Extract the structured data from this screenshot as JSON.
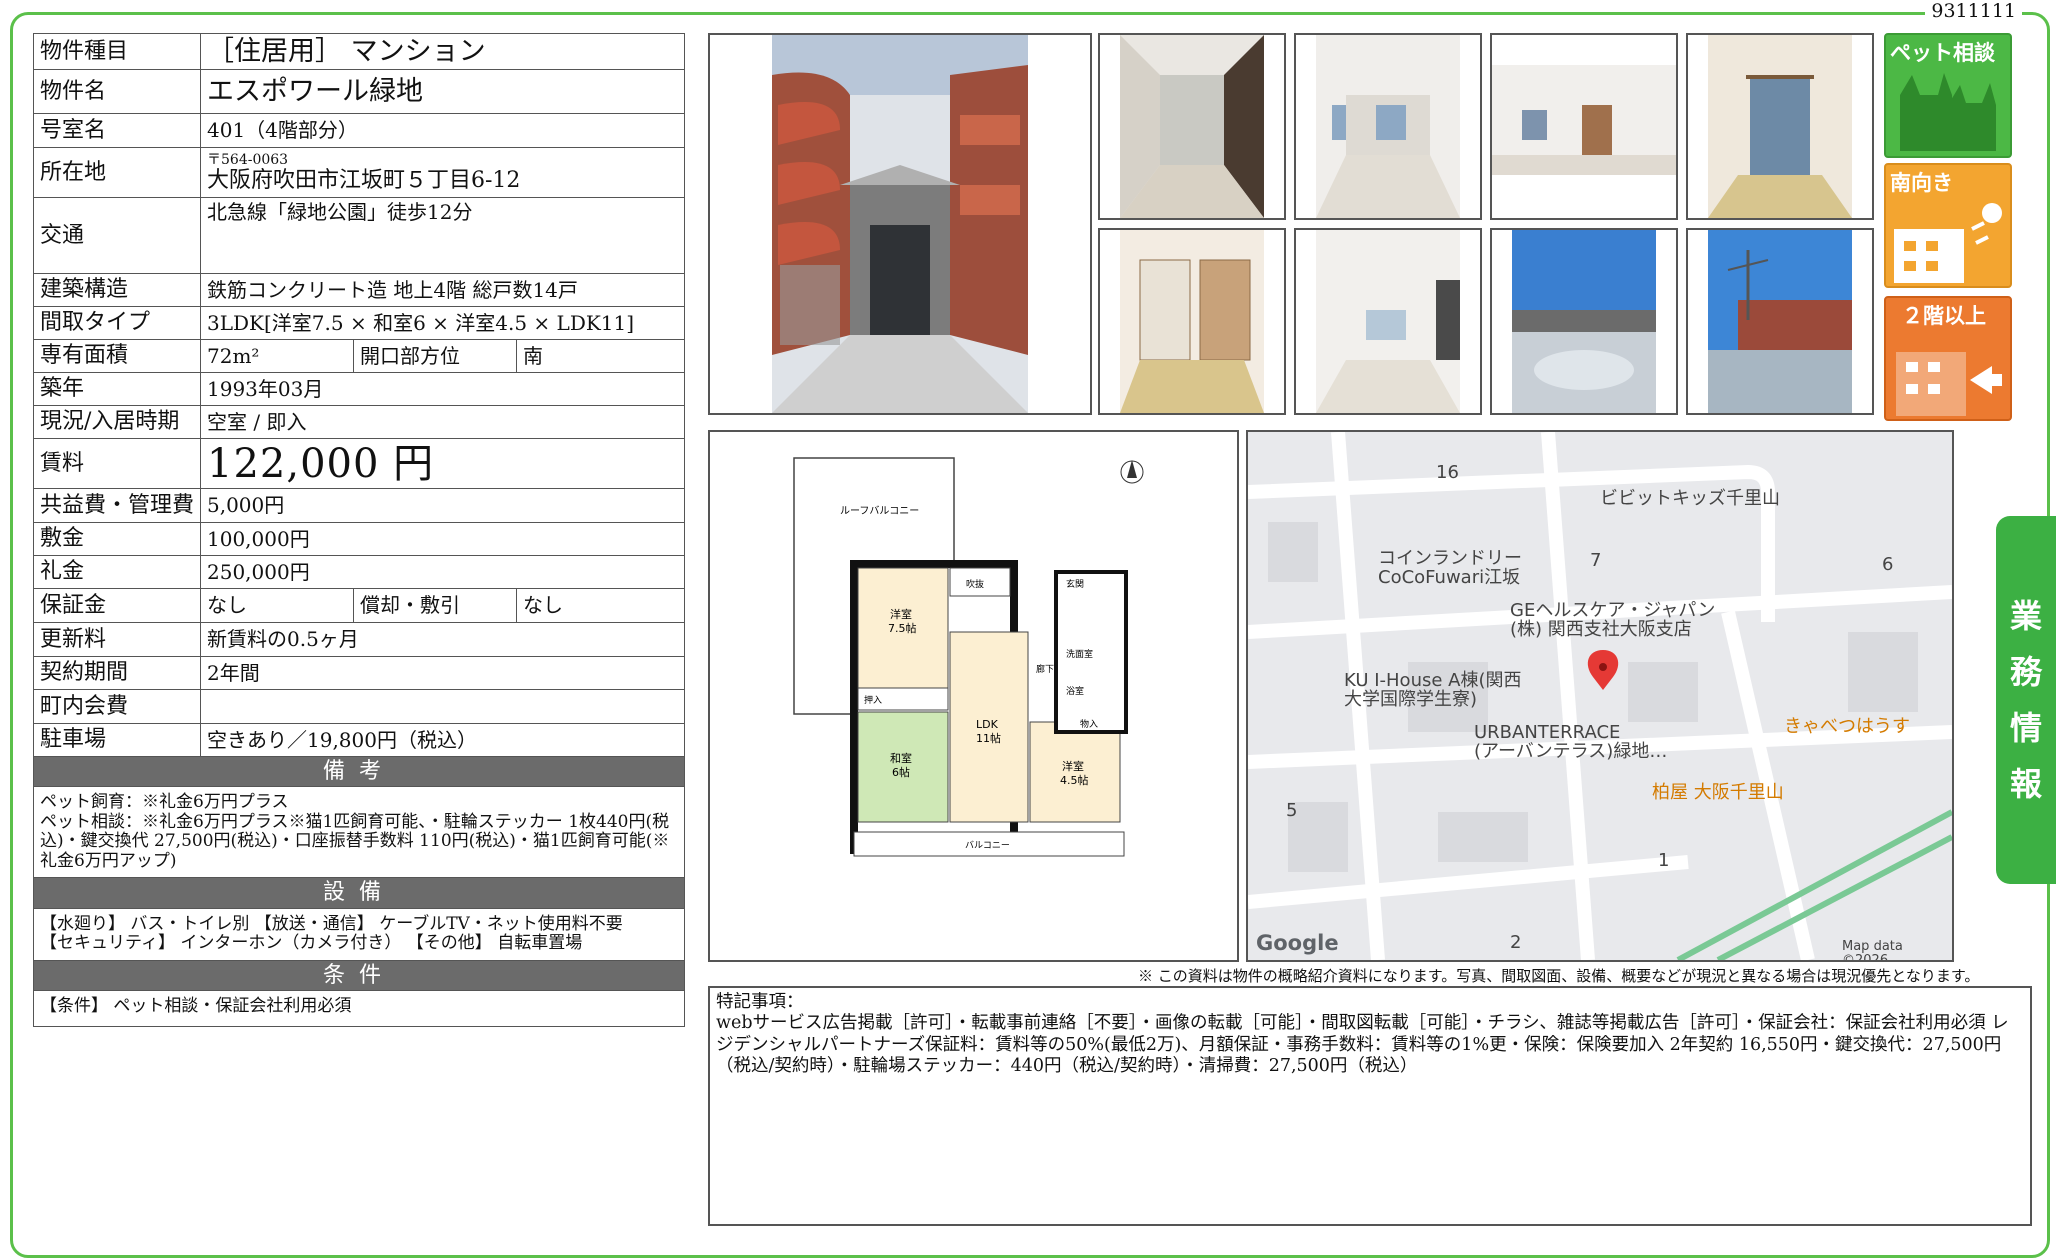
{
  "doc_id": "9311111",
  "property": {
    "type_label": "物件種目",
    "type_value": "［住居用］ マンション",
    "name_label": "物件名",
    "name_value": "エスポワール緑地",
    "room_label": "号室名",
    "room_value": "401（4階部分）",
    "address_label": "所在地",
    "postal": "〒564-0063",
    "address": "大阪府吹田市江坂町５丁目6-12",
    "access_label": "交通",
    "access_value": "北急線「緑地公園」徒歩12分",
    "structure_label": "建築構造",
    "structure_value": "鉄筋コンクリート造 地上4階 総戸数14戸",
    "layout_label": "間取タイプ",
    "layout_value": "3LDK[洋室7.5 × 和室6 × 洋室4.5 × LDK11]",
    "area_label": "専有面積",
    "area_value": "72m²",
    "direction_label": "開口部方位",
    "direction_value": "南",
    "built_label": "築年",
    "built_value": "1993年03月",
    "status_label": "現況/入居時期",
    "status_value": "空室 / 即入",
    "rent_label": "賃料",
    "rent_value": "122,000 円",
    "fee_label": "共益費・管理費",
    "fee_value": "5,000円",
    "deposit_label": "敷金",
    "deposit_value": "100,000円",
    "keymoney_label": "礼金",
    "keymoney_value": "250,000円",
    "guarantee_label": "保証金",
    "guarantee_value": "なし",
    "amort_label": "償却・敷引",
    "amort_value": "なし",
    "renewal_label": "更新料",
    "renewal_value": "新賃料の0.5ヶ月",
    "contract_label": "契約期間",
    "contract_value": "2年間",
    "assoc_label": "町内会費",
    "assoc_value": "",
    "parking_label": "駐車場",
    "parking_value": "空きあり／19,800円（税込）"
  },
  "sections": {
    "remarks_title": "備考",
    "remarks_text": "ペット飼育：※礼金6万円プラス\nペット相談：※礼金6万円プラス※猫1匹飼育可能、・駐輪ステッカー 1枚440円(税込)・鍵交換代 27,500円(税込)・口座振替手数料 110円(税込)・猫1匹飼育可能(※礼金6万円アップ)",
    "facilities_title": "設備",
    "facilities_text": "【水廻り】 バス・トイレ別 【放送・通信】 ケーブルTV・ネット使用料不要\n【セキュリティ】 インターホン（カメラ付き） 【その他】 自転車置場",
    "conditions_title": "条件",
    "conditions_text": "【条件】 ペット相談・保証会社利用必須"
  },
  "badges": [
    "ペット相談",
    "南向き",
    "２階以上"
  ],
  "side_tab": [
    "業",
    "務",
    "情",
    "報"
  ],
  "floorplan": {
    "roof_balcony": "ルーフバルコニー",
    "western1": "洋室",
    "western1_size": "7.5帖",
    "japanese": "和室",
    "japanese_size": "6帖",
    "ldk": "LDK",
    "ldk_size": "11帖",
    "western2": "洋室",
    "western2_size": "4.5帖",
    "balcony": "バルコニー",
    "storage": "物入",
    "closet": "押入",
    "entrance": "玄関",
    "washroom": "洗面室",
    "bath": "浴室",
    "hall": "廊下",
    "fukinuke": "吹抜"
  },
  "map": {
    "pois": [
      "ビビットキッズ千里山",
      "コインランドリー\nCoCoFuwari江坂",
      "GEヘルスケア・ジャパン\n(株) 関西支社大阪支店",
      "KU I-House A棟(関西\n大学国際学生寮)",
      "URBANTERRACE\n(アーバンテラス)緑地…",
      "きゃべつはうす",
      "柏屋 大阪千里山"
    ],
    "numbers": [
      "16",
      "7",
      "6",
      "5",
      "1",
      "2"
    ],
    "brand": "Google",
    "credit": "Map data ©2026"
  },
  "disclaimer": "※ この資料は物件の概略紹介資料になります。写真、間取図面、設備、概要などが現況と異なる場合は現況優先となります。",
  "notes": {
    "title": "特記事項：",
    "text": "webサービス広告掲載［許可］・転載事前連絡［不要］・画像の転載［可能］・間取図転載［可能］・チラシ、雑誌等掲載広告［許可］・保証会社：保証会社利用必須 レジデンシャルパートナーズ保証料：賃料等の50%(最低2万)、月額保証・事務手数料：賃料等の1%更・保険：保険要加入 2年契約 16,550円・鍵交換代：27,500円（税込/契約時）・駐輪場ステッカー：440円（税込/契約時）・清掃費：27,500円（税込）"
  },
  "colors": {
    "frame": "#5bc04a",
    "badge_green": "#4cb845",
    "badge_orange": "#f3a530",
    "badge_red": "#ec7a30",
    "section_bar": "#6b6b6b",
    "pin": "#e53935"
  }
}
